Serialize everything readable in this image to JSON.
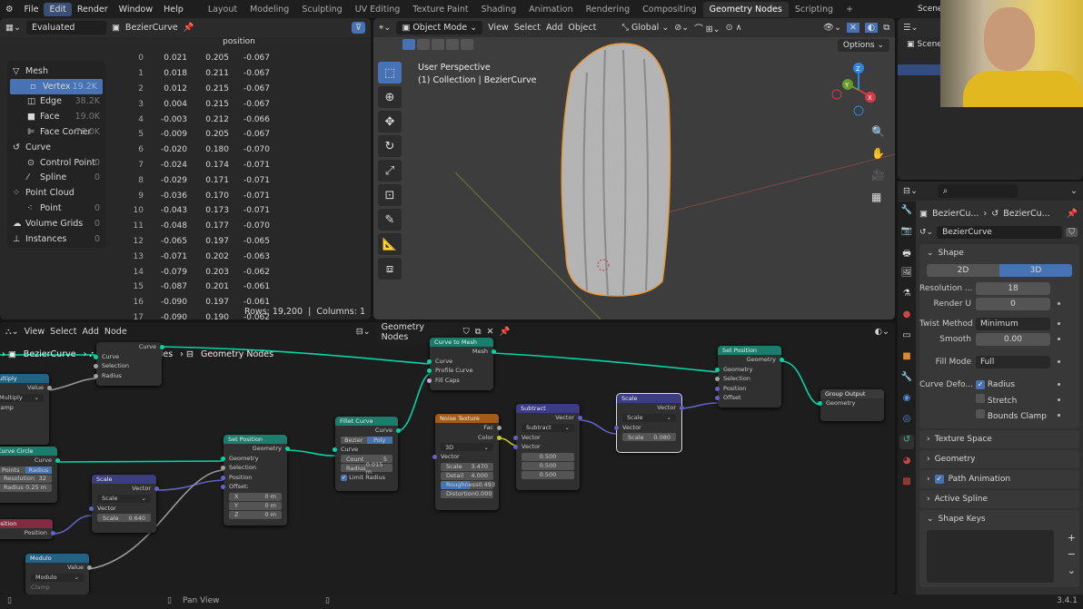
{
  "menu": [
    "File",
    "Edit",
    "Render",
    "Window",
    "Help"
  ],
  "workspaces": [
    "Layout",
    "Modeling",
    "Sculpting",
    "UV Editing",
    "Texture Paint",
    "Shading",
    "Animation",
    "Rendering",
    "Compositing",
    "Geometry Nodes",
    "Scripting",
    "+"
  ],
  "scene": "Scene",
  "spreadsheet": {
    "mode": "Evaluated",
    "object": "BezierCurve",
    "column_header": "position",
    "tree": [
      {
        "label": "Mesh",
        "level": 0,
        "count": ""
      },
      {
        "label": "Vertex",
        "level": 1,
        "count": "19.2K",
        "active": true
      },
      {
        "label": "Edge",
        "level": 1,
        "count": "38.2K"
      },
      {
        "label": "Face",
        "level": 1,
        "count": "19.0K"
      },
      {
        "label": "Face Corner",
        "level": 1,
        "count": "76.0K"
      },
      {
        "label": "Curve",
        "level": 0,
        "count": ""
      },
      {
        "label": "Control Point",
        "level": 1,
        "count": "0"
      },
      {
        "label": "Spline",
        "level": 1,
        "count": "0"
      },
      {
        "label": "Point Cloud",
        "level": 0,
        "count": ""
      },
      {
        "label": "Point",
        "level": 1,
        "count": "0"
      },
      {
        "label": "Volume Grids",
        "level": 0,
        "count": "0"
      },
      {
        "label": "Instances",
        "level": 0,
        "count": "0"
      }
    ],
    "rows": [
      [
        "0",
        "0.021",
        "0.205",
        "-0.067"
      ],
      [
        "1",
        "0.018",
        "0.211",
        "-0.067"
      ],
      [
        "2",
        "0.012",
        "0.215",
        "-0.067"
      ],
      [
        "3",
        "0.004",
        "0.215",
        "-0.067"
      ],
      [
        "4",
        "-0.003",
        "0.212",
        "-0.066"
      ],
      [
        "5",
        "-0.009",
        "0.205",
        "-0.067"
      ],
      [
        "6",
        "-0.020",
        "0.180",
        "-0.070"
      ],
      [
        "7",
        "-0.024",
        "0.174",
        "-0.071"
      ],
      [
        "8",
        "-0.029",
        "0.171",
        "-0.071"
      ],
      [
        "9",
        "-0.036",
        "0.170",
        "-0.071"
      ],
      [
        "10",
        "-0.043",
        "0.173",
        "-0.071"
      ],
      [
        "11",
        "-0.048",
        "0.177",
        "-0.070"
      ],
      [
        "12",
        "-0.065",
        "0.197",
        "-0.065"
      ],
      [
        "13",
        "-0.071",
        "0.202",
        "-0.063"
      ],
      [
        "14",
        "-0.079",
        "0.203",
        "-0.062"
      ],
      [
        "15",
        "-0.087",
        "0.201",
        "-0.061"
      ],
      [
        "16",
        "-0.090",
        "0.197",
        "-0.061"
      ],
      [
        "17",
        "-0.090",
        "0.190",
        "-0.062"
      ]
    ],
    "rows_label": "Rows: 19,200",
    "columns_label": "Columns: 1"
  },
  "viewport": {
    "mode": "Object Mode",
    "menus": [
      "View",
      "Select",
      "Add",
      "Object"
    ],
    "orientation": "Global",
    "options": "Options",
    "overlay_title": "User Perspective",
    "overlay_sub": "(1) Collection | BezierCurve",
    "axes": [
      "X",
      "Y",
      "Z"
    ]
  },
  "outliner": {
    "item": "Scene"
  },
  "node_editor": {
    "menus": [
      "View",
      "Select",
      "Add",
      "Node"
    ],
    "tree_name": "Geometry Nodes",
    "breadcrumb": [
      "BezierCurve",
      "GeometryNodes",
      "Geometry Nodes"
    ],
    "nodes": {
      "multiply": {
        "title": "Multiply",
        "out": "Value",
        "op": "Multiply",
        "clamp": "Clamp"
      },
      "curve_circle": {
        "title": "Curve Circle",
        "out": "Curve",
        "modes": [
          "Points",
          "Radius"
        ],
        "res_label": "Resolution",
        "res": "32",
        "rad_label": "Radius",
        "rad": "0.25 m"
      },
      "position": {
        "title": "Position",
        "out": "Position"
      },
      "modulo": {
        "title": "Modulo",
        "out": "Value",
        "op": "Modulo",
        "clamp": "Clamp"
      },
      "scale1": {
        "title": "Scale",
        "out": "Vector",
        "op": "Scale",
        "in": "Vector",
        "scale_label": "Scale",
        "scale": "0.640"
      },
      "setpos1": {
        "title": "Set Position",
        "out": "Geometry",
        "inputs": [
          "Geometry",
          "Selection",
          "Position",
          "Offset:"
        ],
        "xyz": [
          [
            "X",
            "0 m"
          ],
          [
            "Y",
            "0 m"
          ],
          [
            "Z",
            "0 m"
          ]
        ]
      },
      "fillet": {
        "title": "Fillet Curve",
        "out": "Curve",
        "modes": [
          "Bezier",
          "Poly"
        ],
        "in": "Curve",
        "count_label": "Count",
        "count": "5",
        "rad_label": "Radius",
        "rad": "0.015 m",
        "limit": "Limit Radius"
      },
      "resample": {
        "out": "Curve",
        "inputs": [
          "Curve",
          "Selection",
          "Radius"
        ]
      },
      "curve_to_mesh": {
        "title": "Curve to Mesh",
        "out": "Mesh",
        "inputs": [
          "Curve",
          "Profile Curve",
          "Fill Caps"
        ]
      },
      "noise": {
        "title": "Noise Texture",
        "outs": [
          "Fac",
          "Color"
        ],
        "dim": "3D",
        "in": "Vector",
        "fields": [
          [
            "Scale",
            "3.470"
          ],
          [
            "Detail",
            "4.000"
          ],
          [
            "Roughness",
            "0.493"
          ],
          [
            "Distortion",
            "0.000"
          ]
        ]
      },
      "subtract": {
        "title": "Subtract",
        "out": "Vector",
        "op": "Subtract",
        "inputs": [
          "Vector",
          "Vector"
        ],
        "vals": [
          "0.500",
          "0.500",
          "0.500"
        ]
      },
      "scale2": {
        "title": "Scale",
        "out": "Vector",
        "op": "Scale",
        "in": "Vector",
        "scale_label": "Scale",
        "scale": "0.080"
      },
      "setpos2": {
        "title": "Set Position",
        "out": "Geometry",
        "inputs": [
          "Geometry",
          "Selection",
          "Position",
          "Offset"
        ]
      },
      "output": {
        "title": "Group Output",
        "in": "Geometry"
      }
    }
  },
  "properties": {
    "crumb": [
      "BezierCu...",
      "BezierCu..."
    ],
    "datablock": "BezierCurve",
    "shape": {
      "title": "Shape",
      "dims": [
        "2D",
        "3D"
      ],
      "active_dim": "3D",
      "fields": [
        [
          "Resolution ...",
          "18"
        ],
        [
          "Render U",
          "0"
        ]
      ],
      "twist_label": "Twist Method",
      "twist": "Minimum",
      "smooth_label": "Smooth",
      "smooth": "0.00",
      "fill_label": "Fill Mode",
      "fill": "Full",
      "deform_label": "Curve Defo...",
      "checks": [
        [
          "Radius",
          true
        ],
        [
          "Stretch",
          false
        ],
        [
          "Bounds Clamp",
          false
        ]
      ]
    },
    "panels": [
      "Texture Space",
      "Geometry",
      "Path Animation",
      "Active Spline"
    ],
    "shape_keys": "Shape Keys"
  },
  "status": {
    "action": "Pan View",
    "version": "3.4.1"
  },
  "colors": {
    "accent": "#4772b3",
    "geometry": "#00d6a3",
    "vector": "#6363c7"
  }
}
